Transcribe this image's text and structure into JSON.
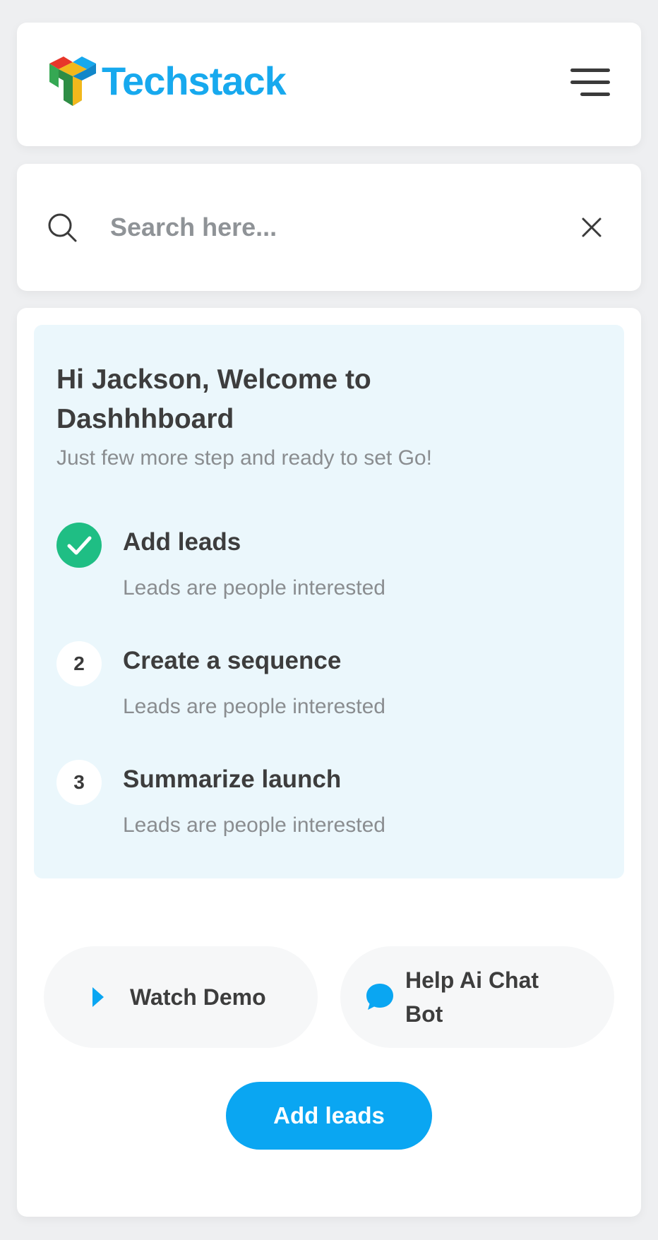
{
  "header": {
    "logo_text": "Techstack",
    "menu_icon": "hamburger-menu-icon"
  },
  "search": {
    "placeholder": "Search here...",
    "value": "",
    "search_icon": "search-icon",
    "clear_icon": "close-icon"
  },
  "welcome": {
    "title": "Hi Jackson, Welcome to Dashhhboard",
    "subtitle": "Just few more step and ready to set Go!",
    "steps": [
      {
        "marker": "",
        "status": "done",
        "title": "Add leads",
        "description": "Leads are people interested"
      },
      {
        "marker": "2",
        "status": "pending",
        "title": "Create a sequence",
        "description": "Leads are people interested"
      },
      {
        "marker": "3",
        "status": "pending",
        "title": "Summarize launch",
        "description": "Leads are people interested"
      }
    ]
  },
  "actions": {
    "watch_demo_label": "Watch Demo",
    "chat_bot_label": "Help Ai Chat Bot",
    "add_leads_label": "Add leads"
  },
  "colors": {
    "brand": "#17a9ee",
    "primary_button": "#0aa6f2",
    "success": "#1fbe84",
    "welcome_bg": "#ebf7fc",
    "text_dark": "#3d3d3d",
    "text_muted": "#8a8d90"
  }
}
